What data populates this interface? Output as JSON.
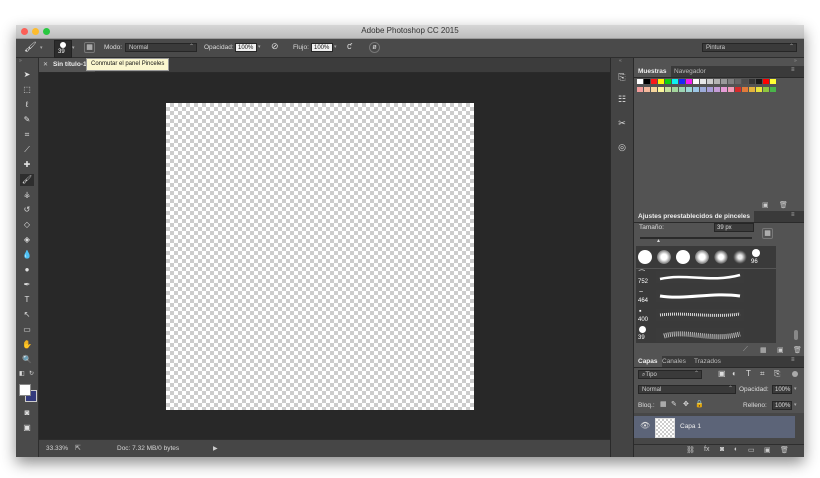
{
  "window": {
    "title": "Adobe Photoshop CC 2015"
  },
  "options_bar": {
    "brush_size": "39",
    "mode_label": "Modo:",
    "mode_value": "Normal",
    "opacity_label": "Opacidad:",
    "opacity_value": "100%",
    "flow_label": "Flujo:",
    "flow_value": "100%",
    "workspace_value": "Pintura"
  },
  "document": {
    "tab_title": "Sin título-1",
    "tooltip": "Conmutar el panel Pinceles"
  },
  "status_bar": {
    "zoom": "33.33%",
    "doc_info": "Doc: 7.32 MB/0 bytes"
  },
  "swatches_panel": {
    "tabs": [
      "Muestras",
      "Navegador"
    ],
    "row1": [
      "#ffffff",
      "#000000",
      "#fa1a1a",
      "#fdf10a",
      "#0ed110",
      "#0ef1f2",
      "#1a27f5",
      "#f41af2",
      "#fafafa",
      "#e6e6e6",
      "#cdcdcd",
      "#b3b3b3",
      "#9a9a9a",
      "#808080",
      "#676767",
      "#4d4d4d",
      "#343434",
      "#1a1a1a",
      "#ff0000",
      "#ffff33"
    ],
    "row2": [
      "#f39c9b",
      "#f5b89c",
      "#f6d59c",
      "#fbf59c",
      "#c6e09c",
      "#a3d59c",
      "#9cd5b3",
      "#9cd6d6",
      "#9cc6e6",
      "#9cabd9",
      "#a69cd6",
      "#c49cd6",
      "#e69cd6",
      "#f19cb9",
      "#d42a2a",
      "#e07a3a",
      "#e5b33c",
      "#e8e33d",
      "#8fc63e",
      "#49b54a"
    ]
  },
  "brush_presets": {
    "title": "Ajustes preestablecidos de pinceles",
    "size_label": "Tamaño:",
    "size_value": "39 px",
    "tip_label": "96",
    "stroke_sizes": [
      "752",
      "464",
      "400",
      "39"
    ]
  },
  "layers_panel": {
    "tabs": [
      "Capas",
      "Canales",
      "Trazados"
    ],
    "filter": "Tipo",
    "blend_mode": "Normal",
    "opacity_label": "Opacidad:",
    "opacity_value": "100%",
    "lock_label": "Bloq.:",
    "fill_label": "Relleno:",
    "fill_value": "100%",
    "layer_name": "Capa 1"
  }
}
